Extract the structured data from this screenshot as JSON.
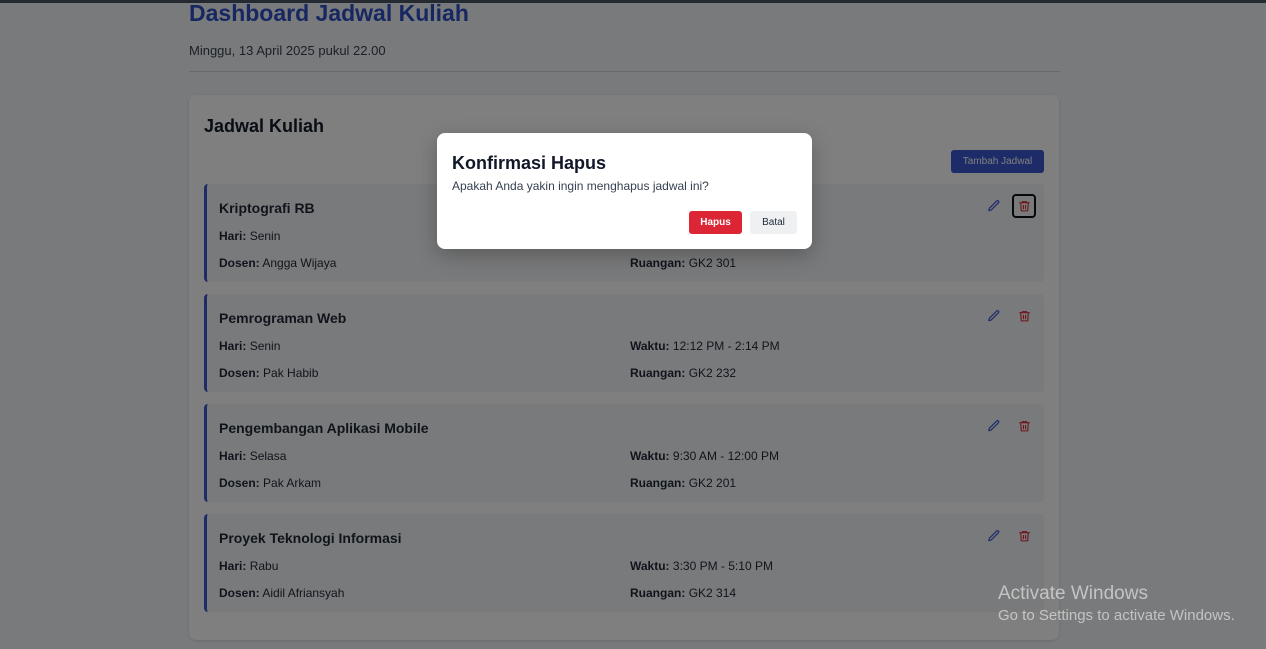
{
  "header": {
    "title": "Dashboard Jadwal Kuliah",
    "datetime": "Minggu, 13 April 2025 pukul 22.00"
  },
  "panel": {
    "title": "Jadwal Kuliah",
    "add_button_label": "Tambah Jadwal"
  },
  "field_labels": {
    "day": "Hari:",
    "lecturer": "Dosen:",
    "time": "Waktu:",
    "room": "Ruangan:"
  },
  "schedules": [
    {
      "course": "Kriptografi RB",
      "day": "Senin",
      "lecturer": "Angga Wijaya",
      "time": "",
      "room": "GK2 301"
    },
    {
      "course": "Pemrograman Web",
      "day": "Senin",
      "lecturer": "Pak Habib",
      "time": "12:12 PM - 2:14 PM",
      "room": "GK2 232"
    },
    {
      "course": "Pengembangan Aplikasi Mobile",
      "day": "Selasa",
      "lecturer": "Pak Arkam",
      "time": "9:30 AM - 12:00 PM",
      "room": "GK2 201"
    },
    {
      "course": "Proyek Teknologi Informasi",
      "day": "Rabu",
      "lecturer": "Aidil Afriansyah",
      "time": "3:30 PM - 5:10 PM",
      "room": "GK2 314"
    }
  ],
  "icons": {
    "edit": "pencil-icon",
    "delete": "trash-icon"
  },
  "modal": {
    "title": "Konfirmasi Hapus",
    "message": "Apakah Anda yakin ingin menghapus jadwal ini?",
    "confirm_label": "Hapus",
    "cancel_label": "Batal"
  },
  "watermark": {
    "title": "Activate Windows",
    "subtitle": "Go to Settings to activate Windows."
  },
  "colors": {
    "accent": "#3b57d0",
    "danger": "#dc2535",
    "overlay": "rgba(0,0,0,0.5)"
  }
}
